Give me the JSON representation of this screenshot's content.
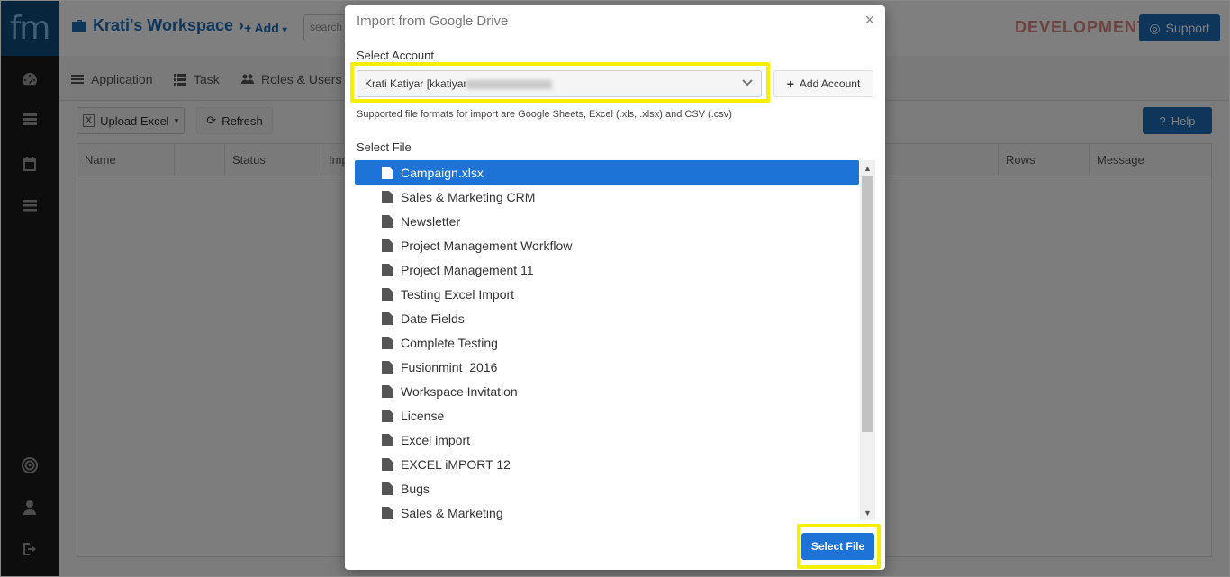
{
  "app": {
    "logo_text": "fm",
    "workspace_title": "Krati's Workspace",
    "add_label": "+ Add",
    "search_placeholder": "search",
    "env_badge": "DEVELOPMENT",
    "support_label": "Support"
  },
  "tabs": [
    {
      "label": "Application",
      "icon": "list-icon"
    },
    {
      "label": "Task",
      "icon": "tasks-icon"
    },
    {
      "label": "Roles & Users",
      "icon": "users-icon"
    }
  ],
  "toolbar": {
    "upload_label": "Upload Excel",
    "refresh_label": "Refresh",
    "help_label": "Help"
  },
  "grid": {
    "columns": [
      "Name",
      "",
      "Status",
      "Imp",
      "Rows",
      "Message"
    ]
  },
  "modal": {
    "title": "Import from Google Drive",
    "close": "×",
    "select_account_label": "Select Account",
    "account_value": "Krati Katiyar [kkatiyar",
    "add_account_label": "Add Account",
    "formats_note": "Supported file formats for import are Google Sheets, Excel (.xls, .xlsx) and CSV (.csv)",
    "select_file_label": "Select File",
    "files": [
      "Campaign.xlsx",
      "Sales & Marketing CRM",
      "Newsletter",
      "Project Management Workflow",
      "Project Management 11",
      "Testing Excel Import",
      "Date Fields",
      "Complete Testing",
      "Fusionmint_2016",
      "Workspace Invitation",
      "License",
      "Excel import",
      "EXCEL iMPORT 12",
      "Bugs",
      "Sales & Marketing"
    ],
    "selected_file": "Campaign.xlsx",
    "select_button": "Select File"
  },
  "colors": {
    "brand": "#1d6bb5",
    "selected": "#1e73d6",
    "highlight": "#f6f000",
    "sidebar": "#1b1b1b"
  }
}
